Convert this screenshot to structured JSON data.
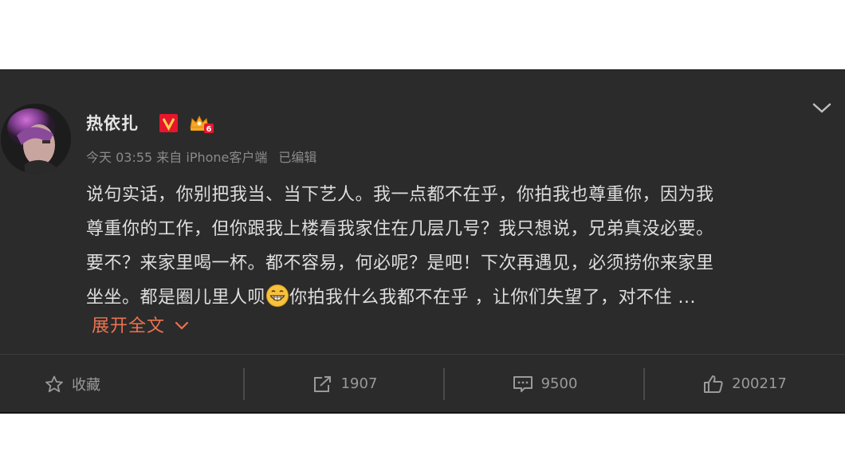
{
  "post": {
    "username": "热依扎",
    "badge_level": "6",
    "time": "今天 03:55",
    "source": "来自 iPhone客户端",
    "edited": "已编辑",
    "lines": [
      "说句实话，你别把我当、当下艺人。我一点都不在乎，你拍我也尊重你，因为我",
      "尊重你的工作，但你跟我上楼看我家住在几层几号？我只想说，兄弟真没必要。",
      "要不？来家里喝一杯。都不容易，何必呢？是吧！下次再遇见，必须捞你来家里",
      "坐坐。都是圈儿里人呗"
    ],
    "line4_after_emoji": "你拍我什么我都不在乎 ，让你们失望了，对不住 ...",
    "expand_label": "展开全文"
  },
  "actions": {
    "favorite_label": "收藏",
    "repost_count": "1907",
    "comment_count": "9500",
    "like_count": "200217"
  },
  "colors": {
    "card_bg": "#2b2b2b",
    "text": "#dedede",
    "meta": "#8a8a8a",
    "accent": "#eb7350",
    "vip_red": "#e6162d",
    "crown_gold": "#f5a623"
  }
}
